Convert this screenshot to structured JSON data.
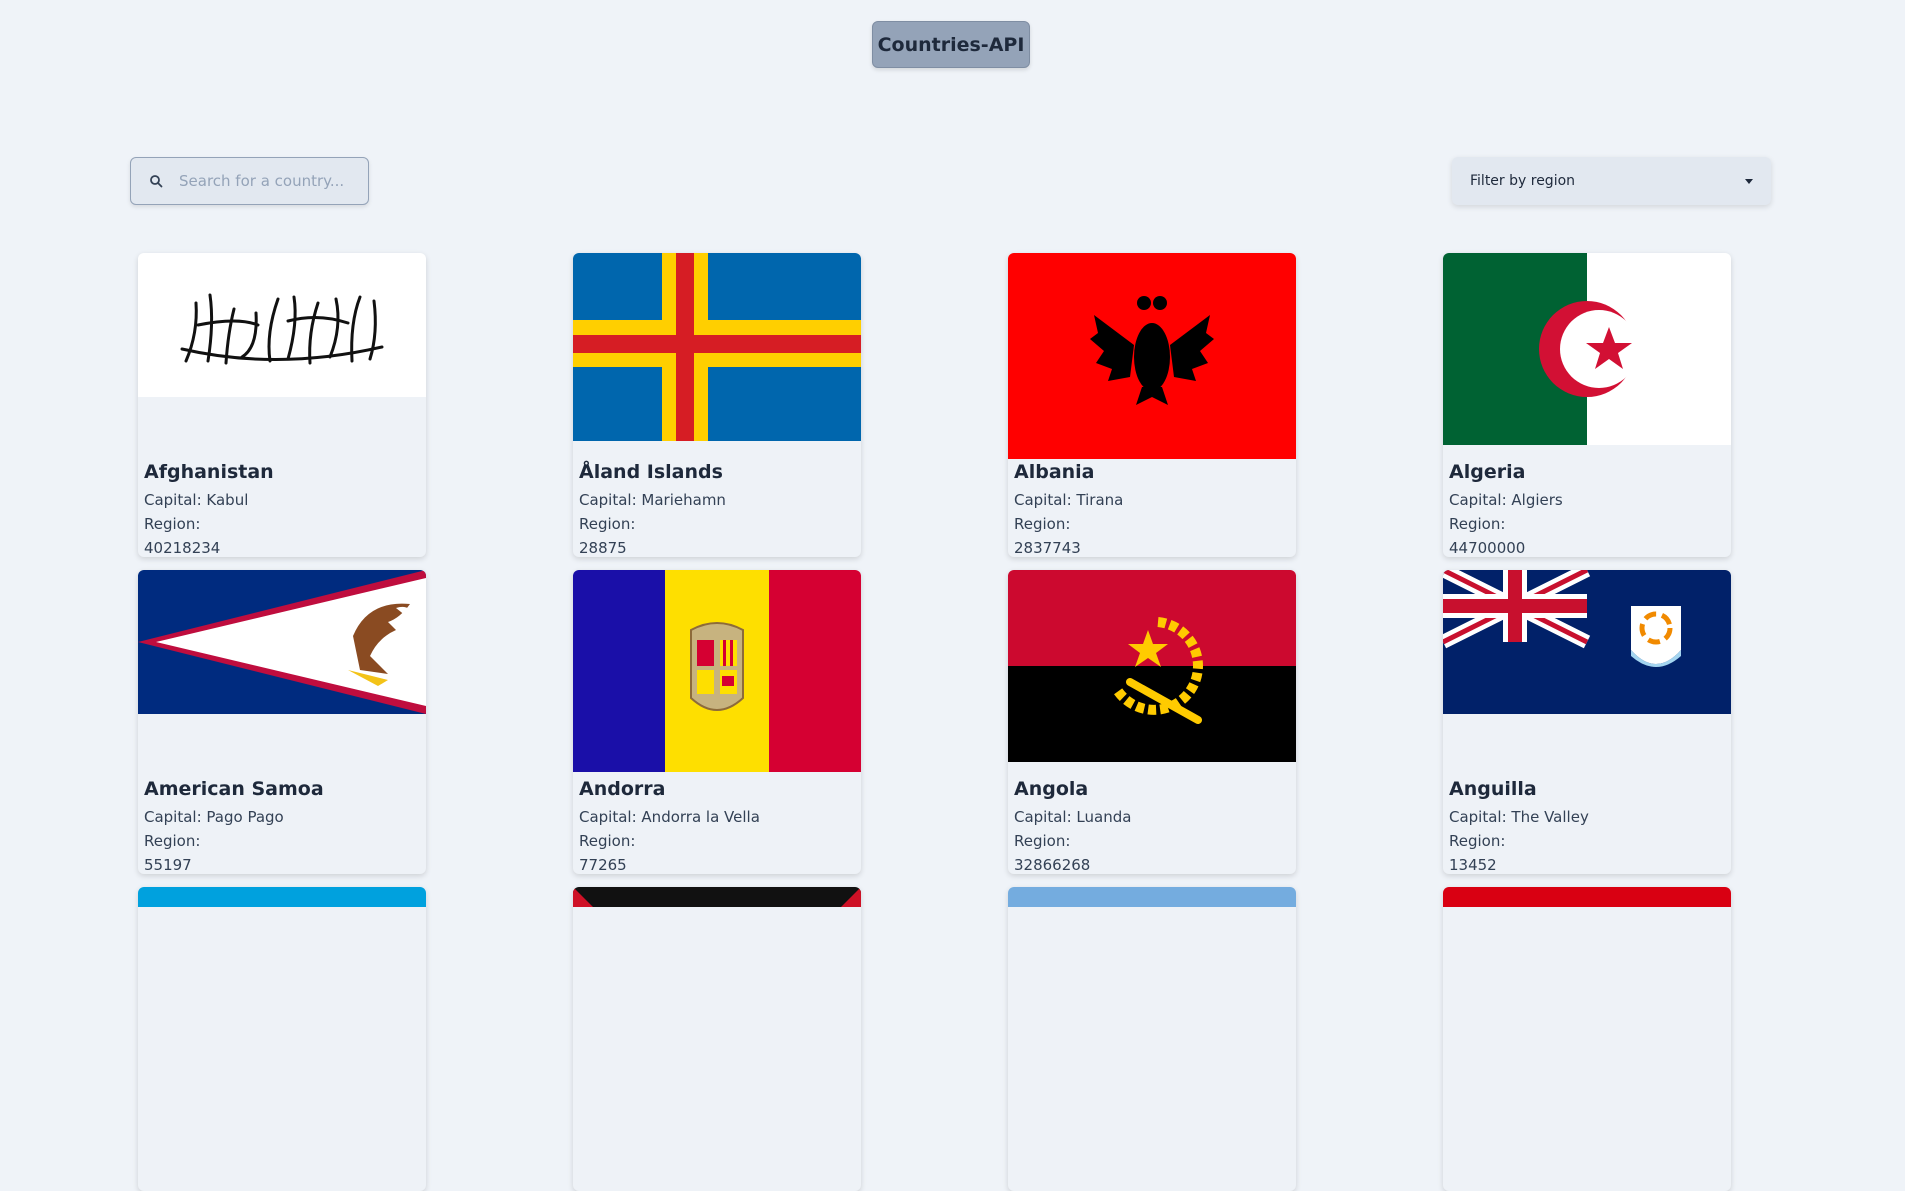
{
  "header": {
    "title": "Countries-API"
  },
  "search": {
    "placeholder": "Search for a country...",
    "icon": "search-icon"
  },
  "filter": {
    "label": "Filter by region",
    "icon": "chevron-down-icon"
  },
  "labels": {
    "capital_prefix": "Capital: ",
    "region_label": "Region:"
  },
  "countries": [
    {
      "name": "Afghanistan",
      "capital": "Kabul",
      "population": "40218234",
      "flag": "afghanistan-flag"
    },
    {
      "name": "Åland Islands",
      "capital": "Mariehamn",
      "population": "28875",
      "flag": "aland-flag"
    },
    {
      "name": "Albania",
      "capital": "Tirana",
      "population": "2837743",
      "flag": "albania-flag"
    },
    {
      "name": "Algeria",
      "capital": "Algiers",
      "population": "44700000",
      "flag": "algeria-flag"
    },
    {
      "name": "American Samoa",
      "capital": "Pago Pago",
      "population": "55197",
      "flag": "american-samoa-flag"
    },
    {
      "name": "Andorra",
      "capital": "Andorra la Vella",
      "population": "77265",
      "flag": "andorra-flag"
    },
    {
      "name": "Angola",
      "capital": "Luanda",
      "population": "32866268",
      "flag": "angola-flag"
    },
    {
      "name": "Anguilla",
      "capital": "The Valley",
      "population": "13452",
      "flag": "anguilla-flag"
    }
  ],
  "colors": {
    "background": "#eff3f8",
    "card": "#eef2f7",
    "header_button": "#94a3b8"
  }
}
